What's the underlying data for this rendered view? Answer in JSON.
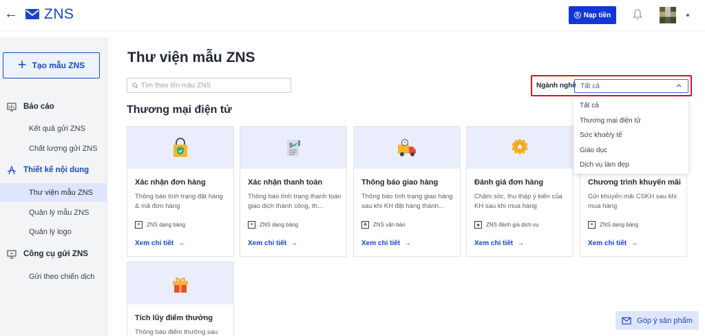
{
  "header": {
    "back_icon": "arrow-left-icon",
    "logo_text": "ZNS",
    "topup_label": "Nạp tiền",
    "colors": {
      "brand": "#1847c8",
      "topup_bg": "#1137d6"
    }
  },
  "sidebar": {
    "create_label": "Tạo mẫu ZNS",
    "sections": [
      {
        "label": "Báo cáo",
        "icon": "chart-icon",
        "items": [
          "Kết quả gửi ZNS",
          "Chất lượng gửi ZNS"
        ]
      },
      {
        "label": "Thiết kế nội dung",
        "icon": "design-icon",
        "items": [
          "Thư viện mẫu ZNS",
          "Quản lý mẫu ZNS",
          "Quản lý logo"
        ]
      },
      {
        "label": "Công cụ gửi ZNS",
        "icon": "monitor-icon",
        "items": [
          "Gửi theo chiến dịch"
        ]
      }
    ]
  },
  "main": {
    "title": "Thư viện mẫu ZNS",
    "search_placeholder": "Tìm theo tên mẫu ZNS",
    "section_title": "Thương mại điện tử",
    "filter": {
      "label": "Ngành nghề",
      "selected": "Tất cả",
      "options": [
        "Tất cả",
        "Thương mại điện tử",
        "Sức khoẻ/y tế",
        "Giáo dục",
        "Dịch vụ làm đẹp"
      ]
    },
    "cards": [
      {
        "title": "Xác nhận đơn hàng",
        "desc": "Thông báo tình trạng đặt hàng & mã đơn hàng",
        "type": "ZNS dạng bảng",
        "link": "Xem chi tiết",
        "icon": "shopping-bag-icon"
      },
      {
        "title": "Xác nhận thanh toán",
        "desc": "Thông báo tình trạng thanh toán giao dịch thành công, th...",
        "type": "ZNS dạng bảng",
        "link": "Xem chi tiết",
        "icon": "invoice-icon"
      },
      {
        "title": "Thông báo giao hàng",
        "desc": "Thông báo tình trạng giao hàng sau khi KH đặt hàng thành...",
        "type": "ZNS văn bản",
        "link": "Xem chi tiết",
        "icon": "delivery-truck-icon"
      },
      {
        "title": "Đánh giá đơn hàng",
        "desc": "Chăm sóc, thu thập ý kiến của KH sau khi mua hàng",
        "type": "ZNS đánh giá dịch vụ",
        "link": "Xem chi tiết",
        "icon": "star-badge-icon"
      },
      {
        "title": "Chương trình khuyến mãi",
        "desc": "Gửi khuyến mãi CSKH sau khi mua hàng",
        "type": "ZNS dạng bảng",
        "link": "Xem chi tiết",
        "icon": "promotion-icon"
      },
      {
        "title": "Tích lũy điểm thưởng",
        "desc": "Thông báo điểm thưởng sau",
        "type": "",
        "link": "",
        "icon": "gift-icon"
      }
    ],
    "feedback_label": "Góp ý sản phẩm"
  }
}
